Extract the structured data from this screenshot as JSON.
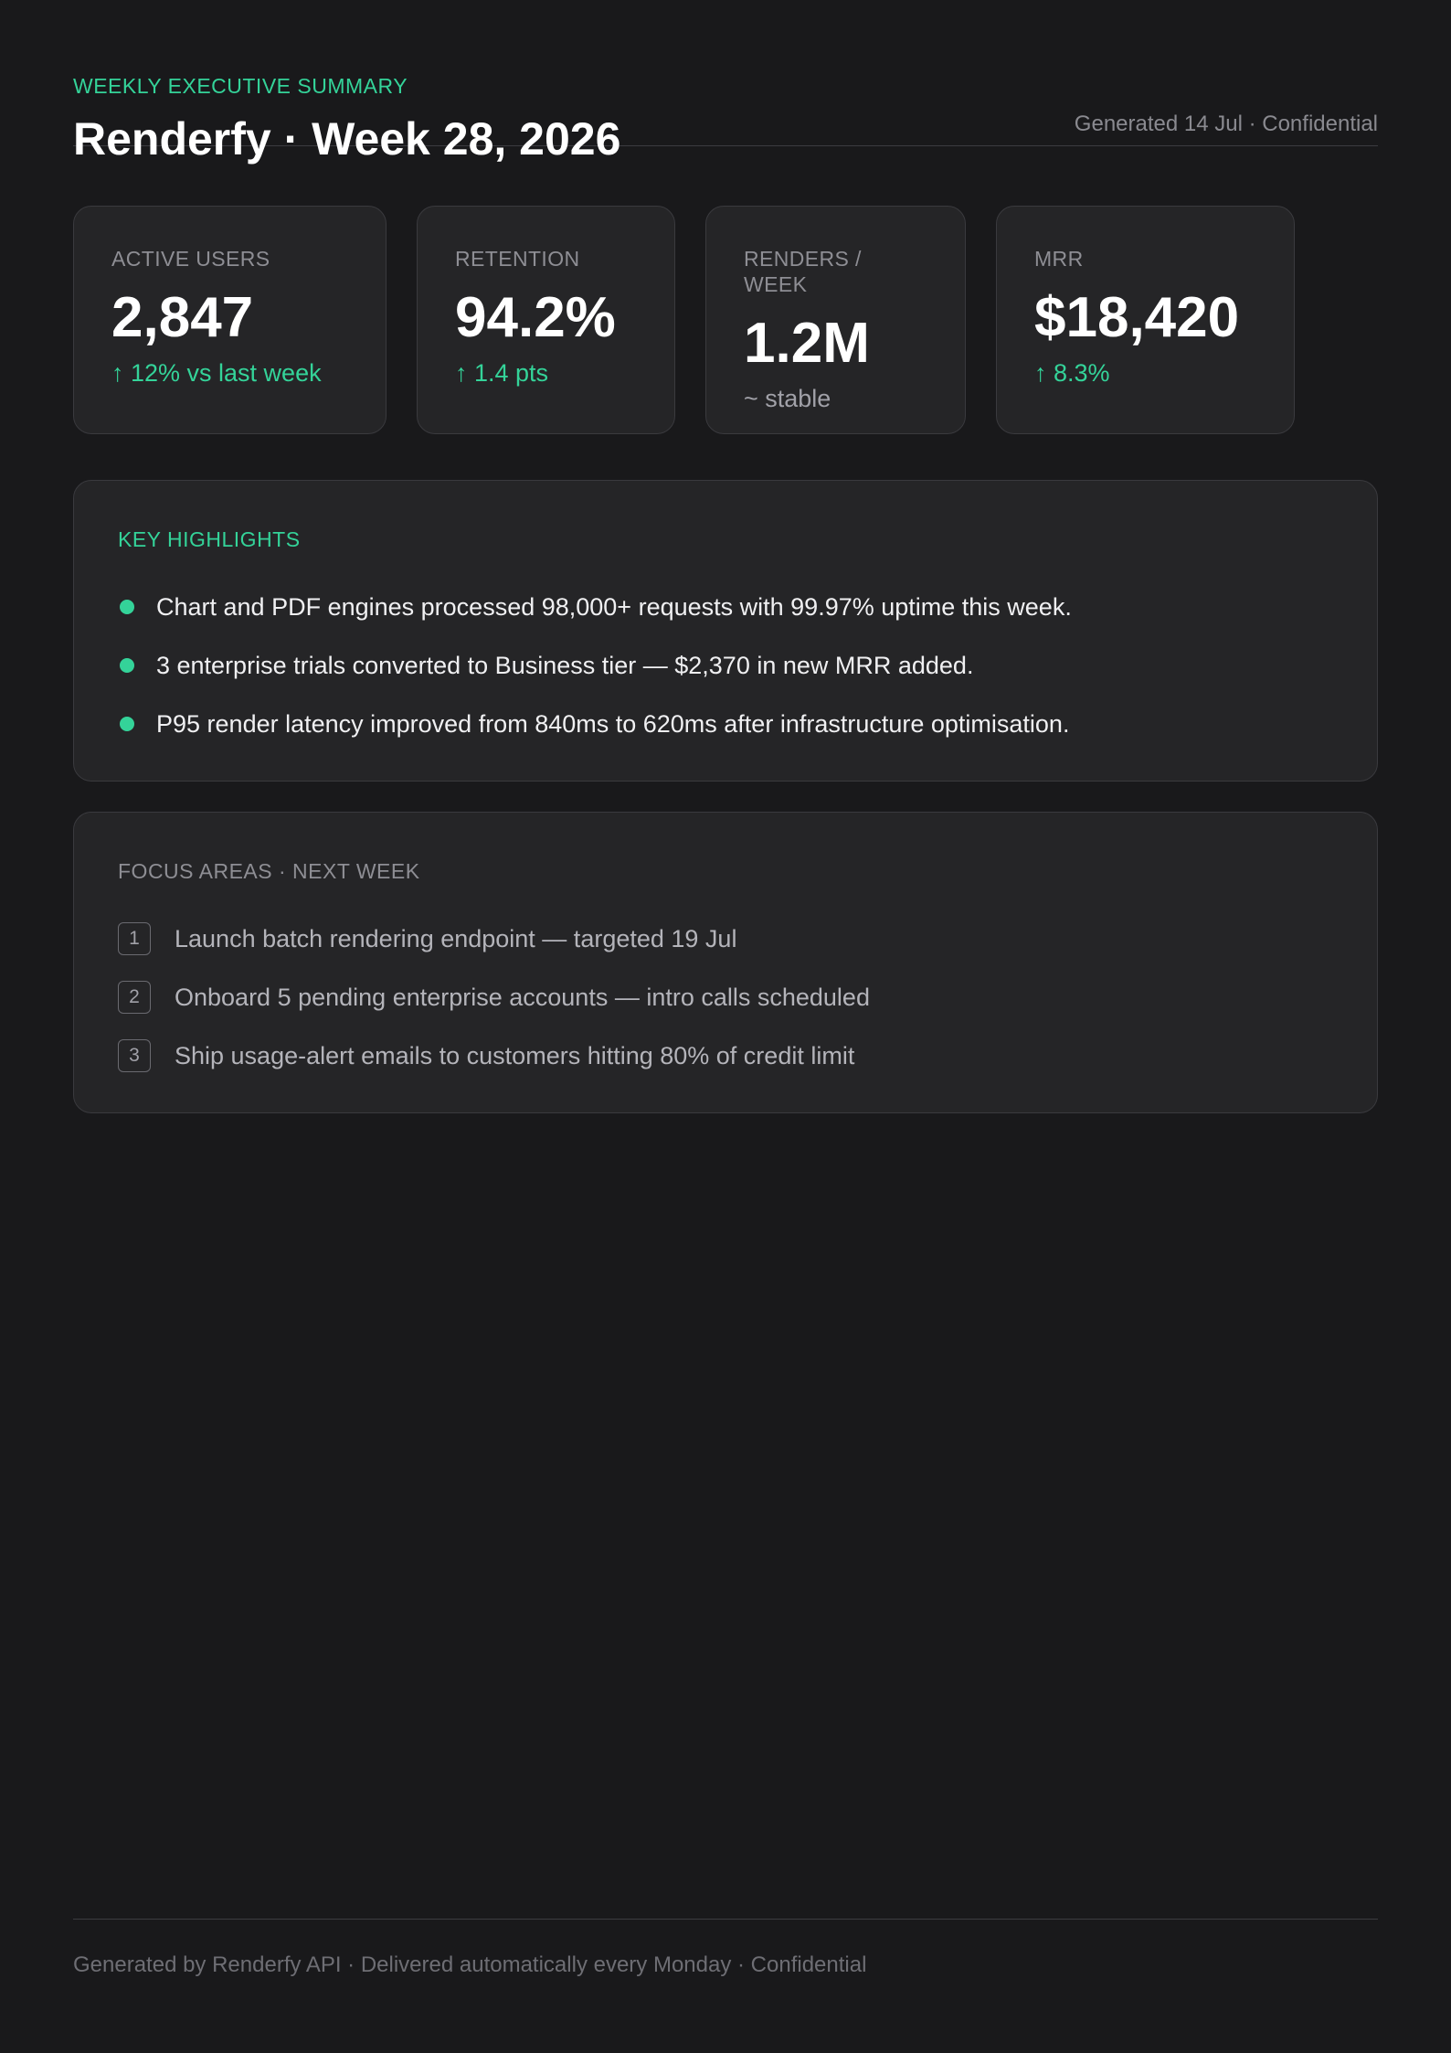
{
  "header": {
    "eyebrow": "WEEKLY EXECUTIVE SUMMARY",
    "title": "Renderfy · Week 28, 2026",
    "generated": "Generated 14 Jul · Confidential"
  },
  "metrics": [
    {
      "label": "ACTIVE USERS",
      "value": "2,847",
      "delta": "↑ 12% vs last week",
      "trend": "up"
    },
    {
      "label": "RETENTION",
      "value": "94.2%",
      "delta": "↑ 1.4 pts",
      "trend": "up"
    },
    {
      "label": "RENDERS / WEEK",
      "value": "1.2M",
      "delta": "~ stable",
      "trend": "flat"
    },
    {
      "label": "MRR",
      "value": "$18,420",
      "delta": "↑ 8.3%",
      "trend": "up"
    }
  ],
  "highlights": {
    "label": "KEY HIGHLIGHTS",
    "items": [
      "Chart and PDF engines processed 98,000+ requests with 99.97% uptime this week.",
      "3 enterprise trials converted to Business tier — $2,370 in new MRR added.",
      "P95 render latency improved from 840ms to 620ms after infrastructure optimisation."
    ]
  },
  "focus": {
    "label": "FOCUS AREAS · NEXT WEEK",
    "items": [
      {
        "num": "1",
        "text": "Launch batch rendering endpoint — targeted 19 Jul"
      },
      {
        "num": "2",
        "text": "Onboard 5 pending enterprise accounts — intro calls scheduled"
      },
      {
        "num": "3",
        "text": "Ship usage-alert emails to customers hitting 80% of credit limit"
      }
    ]
  },
  "footer": {
    "text": "Generated by Renderfy API · Delivered automatically every Monday · Confidential"
  },
  "colors": {
    "background": "#19191b",
    "card": "#252527",
    "accent": "#34d399",
    "muted": "#8e8e94"
  }
}
